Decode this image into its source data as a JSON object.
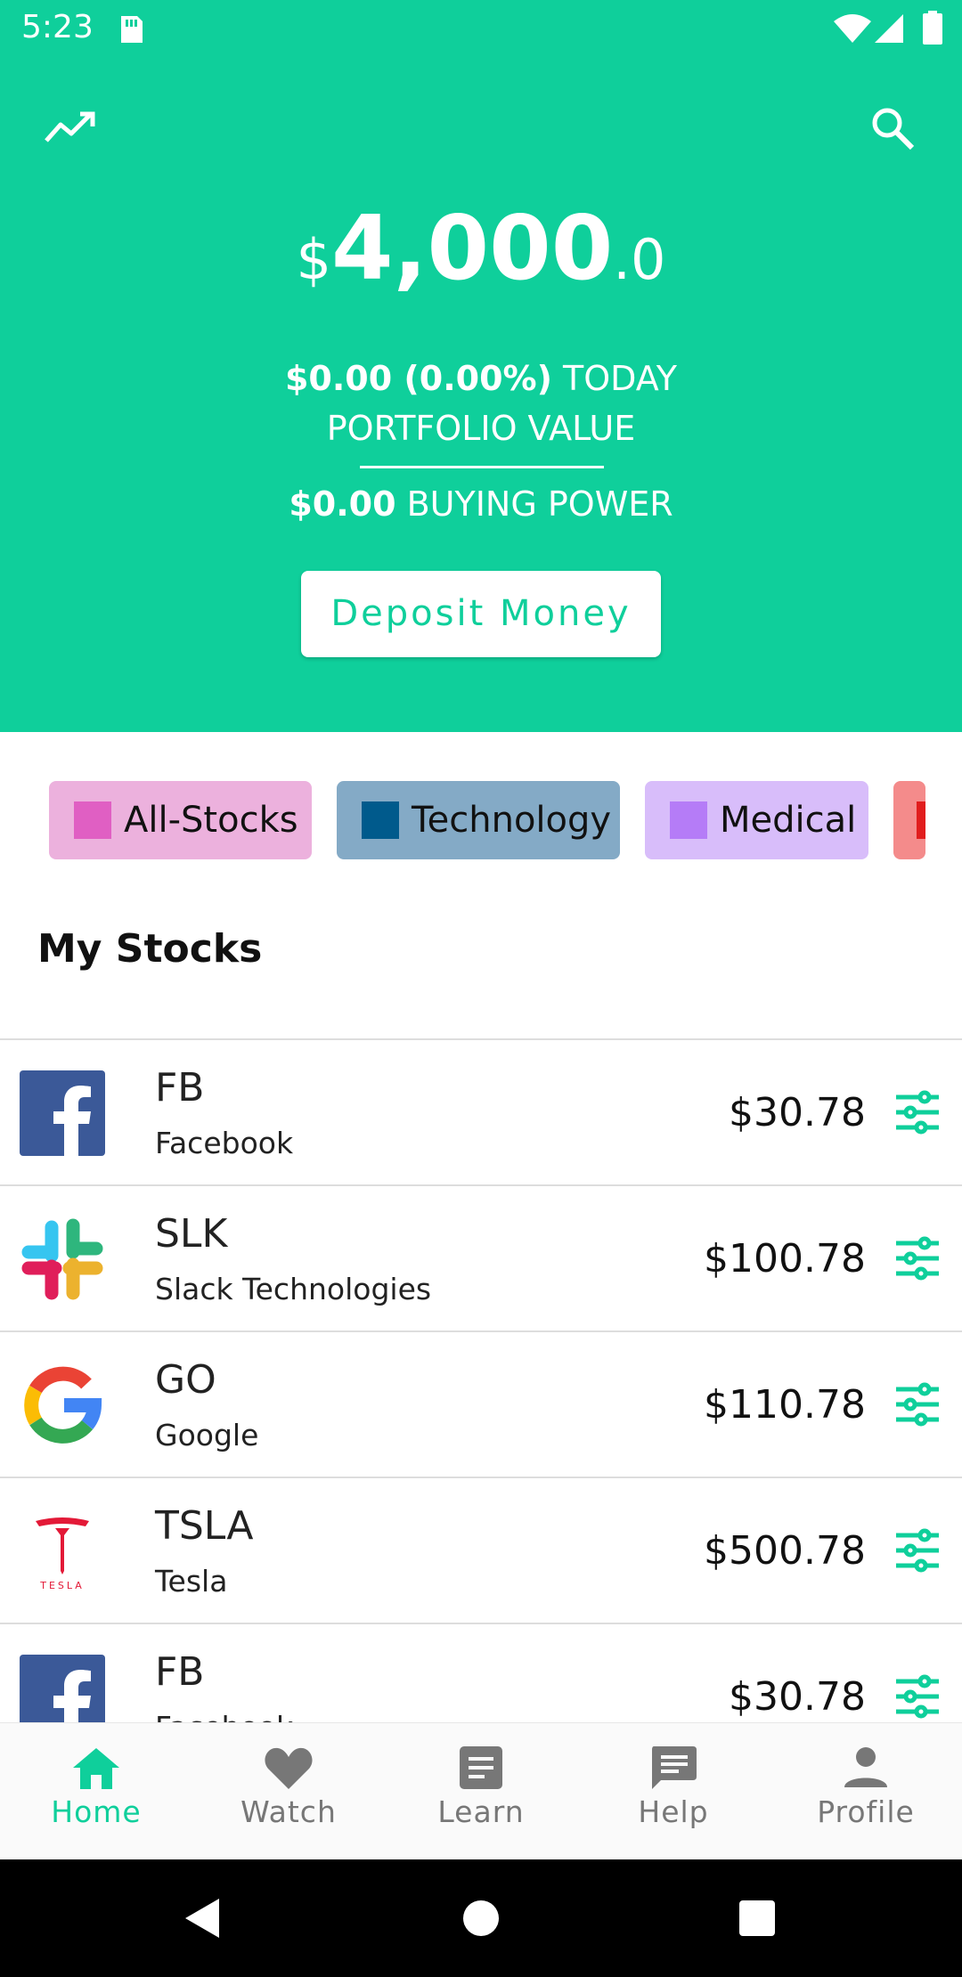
{
  "status": {
    "time": "5:23"
  },
  "header": {
    "trend_icon": "trend-icon",
    "search_icon": "search-icon",
    "currency": "$",
    "amount_major": "4,000",
    "amount_minor": ".0",
    "today_change": "$0.00 (0.00%)",
    "today_label": "TODAY",
    "portfolio_label": "PORTFOLIO VALUE",
    "buying_power": "$0.00",
    "buying_power_label": "BUYING POWER",
    "deposit_label": "Deposit Money"
  },
  "categories": [
    {
      "label": "All-Stocks",
      "bg": "#ecb1dd",
      "swatch": "#e05fc3"
    },
    {
      "label": "Technology",
      "bg": "#84aac6",
      "swatch": "#005a8c"
    },
    {
      "label": "Medical",
      "bg": "#d8bdfa",
      "swatch": "#b57cf7"
    },
    {
      "label": "",
      "bg": "#f48b8b",
      "swatch": "#e11d1d"
    }
  ],
  "section_title": "My Stocks",
  "stocks": [
    {
      "symbol": "FB",
      "name": "Facebook",
      "price": "$30.78",
      "logo": "facebook-logo"
    },
    {
      "symbol": "SLK",
      "name": "Slack Technologies",
      "price": "$100.78",
      "logo": "slack-logo"
    },
    {
      "symbol": "GO",
      "name": "Google",
      "price": "$110.78",
      "logo": "google-logo"
    },
    {
      "symbol": "TSLA",
      "name": "Tesla",
      "price": "$500.78",
      "logo": "tesla-logo"
    },
    {
      "symbol": "FB",
      "name": "Facebook",
      "price": "$30.78",
      "logo": "facebook-logo"
    }
  ],
  "nav": [
    {
      "label": "Home",
      "icon": "home-icon",
      "active": true
    },
    {
      "label": "Watch",
      "icon": "heart-icon",
      "active": false
    },
    {
      "label": "Learn",
      "icon": "article-icon",
      "active": false
    },
    {
      "label": "Help",
      "icon": "chat-icon",
      "active": false
    },
    {
      "label": "Profile",
      "icon": "person-icon",
      "active": false
    }
  ],
  "colors": {
    "accent": "#0fcf9b",
    "tesla_text": "TESLA"
  }
}
